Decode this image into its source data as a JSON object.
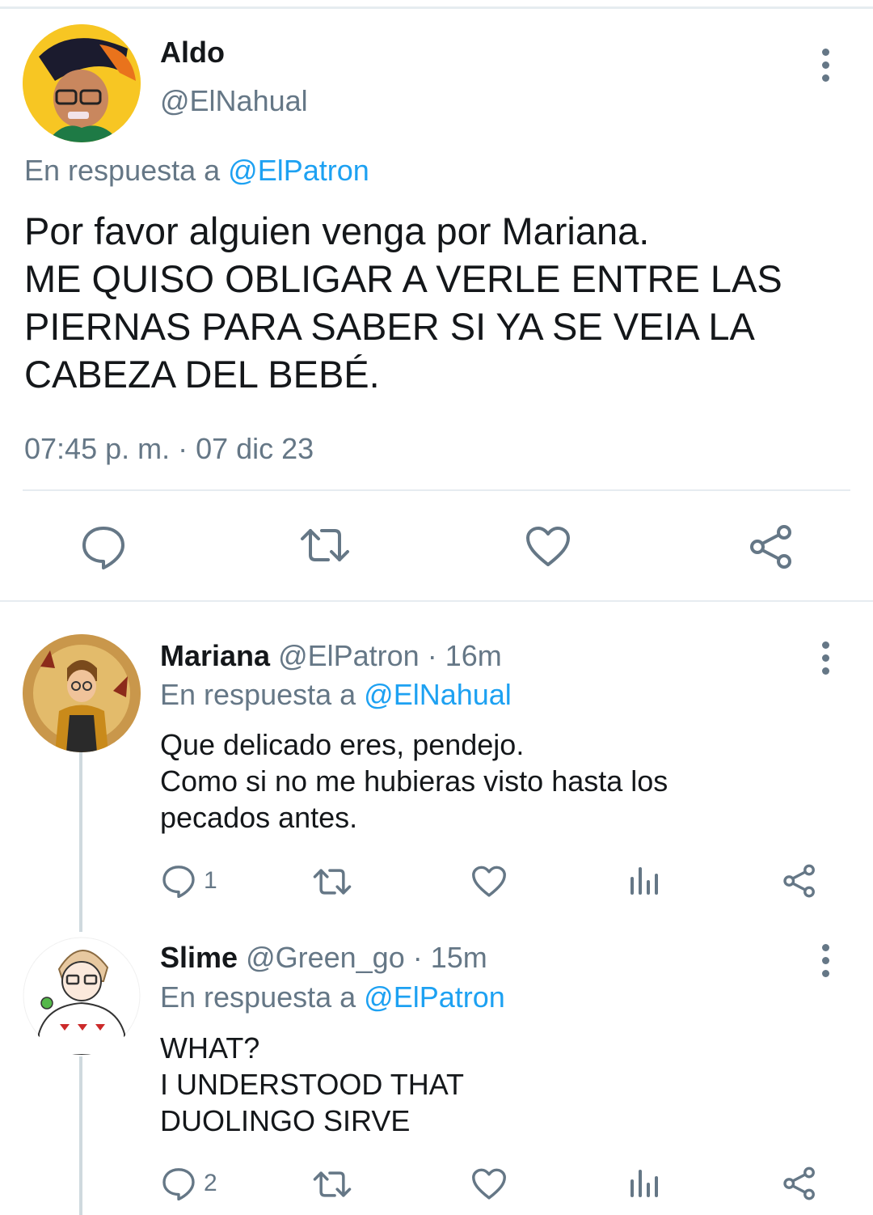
{
  "main_tweet": {
    "name": "Aldo",
    "handle": "@ElNahual",
    "reply_prefix": "En respuesta a",
    "reply_to": "@ElPatron",
    "text_lines": [
      "Por favor alguien venga por Mariana.",
      "ME QUISO OBLIGAR A VERLE ENTRE LAS",
      "PIERNAS PARA SABER SI YA SE VEIA LA",
      "CABEZA DEL BEBÉ."
    ],
    "timestamp": "07:45 p. m. · 07 dic 23",
    "actions": [
      "reply-icon",
      "retweet-icon",
      "like-icon",
      "share-icon"
    ]
  },
  "replies": [
    {
      "name": "Mariana",
      "handle": "@ElPatron",
      "time": "· 16m",
      "reply_prefix": "En respuesta a",
      "reply_to": "@ElNahual",
      "text_lines": [
        "Que delicado eres, pendejo.",
        "Como si no me hubieras visto hasta los",
        "pecados antes."
      ],
      "reply_count": "1"
    },
    {
      "name": "Slime",
      "handle": "@Green_go",
      "time": "· 15m",
      "reply_prefix": "En respuesta a",
      "reply_to": "@ElPatron",
      "text_lines": [
        "WHAT?",
        "I UNDERSTOOD THAT",
        "DUOLINGO SIRVE"
      ],
      "reply_count": "2"
    }
  ],
  "colors": {
    "accent": "#1da1f2",
    "muted": "#657786",
    "text": "#14171a",
    "divider": "#e6ecf0"
  }
}
